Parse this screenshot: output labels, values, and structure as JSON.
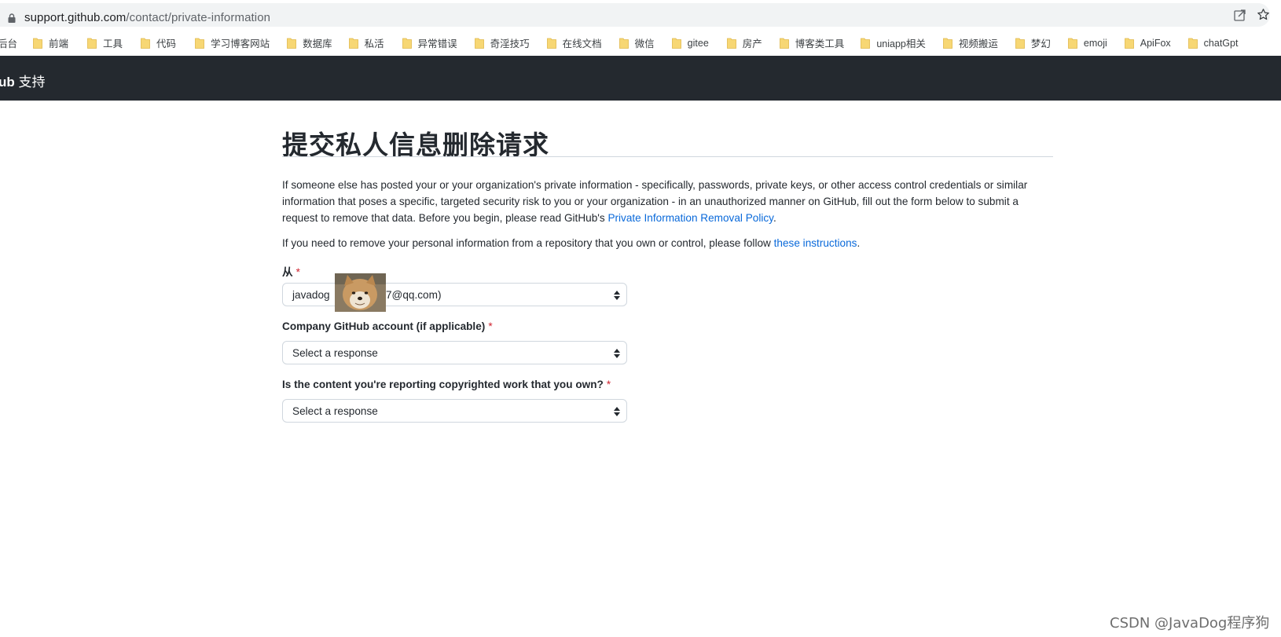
{
  "browser": {
    "url_host": "support.github.com",
    "url_path": "/contact/private-information",
    "bookmarks": [
      {
        "label": "后台"
      },
      {
        "label": "前端"
      },
      {
        "label": "工具"
      },
      {
        "label": "代码"
      },
      {
        "label": "学习博客网站"
      },
      {
        "label": "数据库"
      },
      {
        "label": "私活"
      },
      {
        "label": "异常错误"
      },
      {
        "label": "奇淫技巧"
      },
      {
        "label": "在线文档"
      },
      {
        "label": "微信"
      },
      {
        "label": "gitee"
      },
      {
        "label": "房产"
      },
      {
        "label": "博客类工具"
      },
      {
        "label": "uniapp相关"
      },
      {
        "label": "视频搬运"
      },
      {
        "label": "梦幻"
      },
      {
        "label": "emoji"
      },
      {
        "label": "ApiFox"
      },
      {
        "label": "chatGpt"
      }
    ]
  },
  "header": {
    "brand_bold": "ub",
    "brand_rest": " 支持"
  },
  "page": {
    "title": "提交私人信息删除请求",
    "intro_text_1": "If someone else has posted your or your organization's private information - specifically, passwords, private keys, or other access control credentials or similar information that poses a specific, targeted security risk to you or your organization - in an unauthorized manner on GitHub, fill out the form below to submit a request to remove that data. Before you begin, please read GitHub's ",
    "intro_link_1": "Private Information Removal Policy",
    "intro_tail_1": ".",
    "intro_text_2": "If you need to remove your personal information from a repository that you own or control, please follow ",
    "intro_link_2": "these instructions",
    "intro_tail_2": "."
  },
  "form": {
    "from": {
      "label": "从",
      "required_mark": "*",
      "value_prefix": "javadog",
      "value_suffix": "7@qq.com)"
    },
    "company": {
      "label": "Company GitHub account (if applicable)",
      "required_mark": "*",
      "value": "Select a response"
    },
    "copyright": {
      "label": "Is the content you're reporting copyrighted work that you own?",
      "required_mark": "*",
      "value": "Select a response"
    }
  },
  "watermark": "CSDN @JavaDog程序狗",
  "colors": {
    "header_bg": "#24292f",
    "link": "#0969da",
    "required": "#cf222e",
    "folder": "#f7d774"
  }
}
